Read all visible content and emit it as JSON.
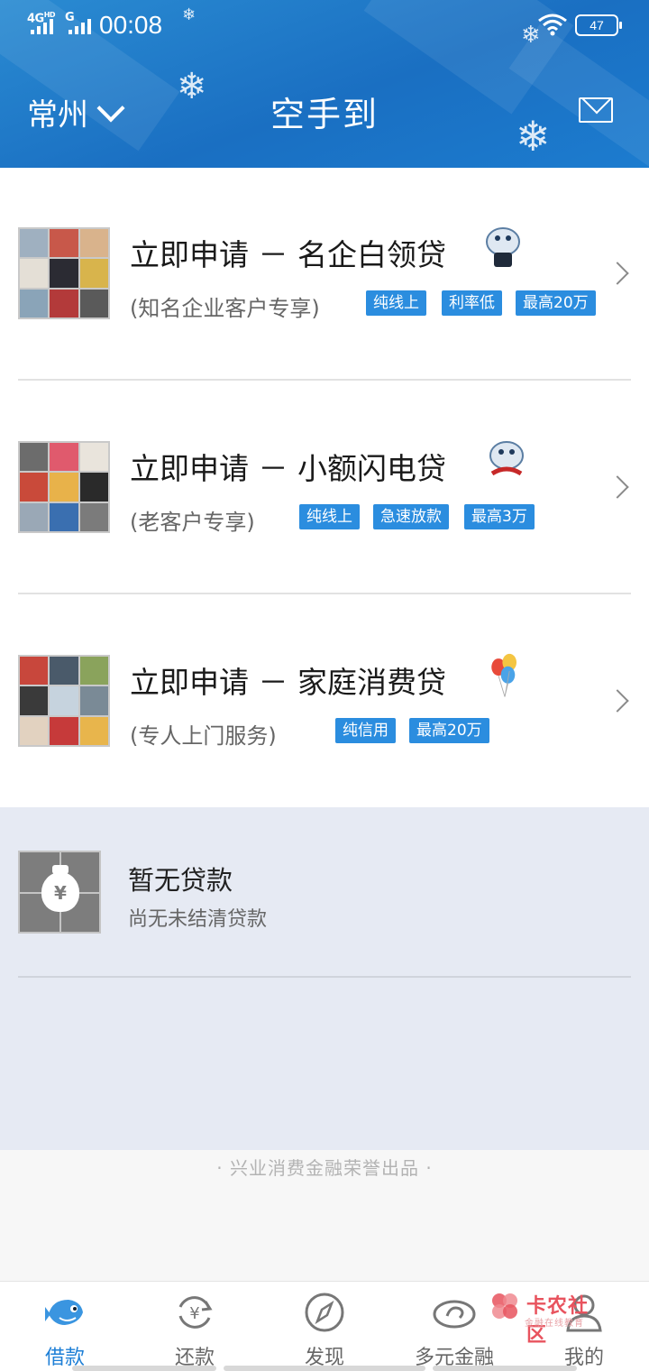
{
  "status_bar": {
    "network": "4G",
    "network_sup": "HD",
    "network2": "G",
    "time": "00:08",
    "battery": "47"
  },
  "header": {
    "city": "常州",
    "title": "空手到"
  },
  "loans": [
    {
      "title": "立即申请 － 名企白领贷",
      "subtitle": "(知名企业客户专享)",
      "tags": [
        "纯线上",
        "利率低",
        "最高20万"
      ]
    },
    {
      "title": "立即申请 － 小额闪电贷",
      "subtitle": "(老客户专享)",
      "tags": [
        "纯线上",
        "急速放款",
        "最高3万"
      ]
    },
    {
      "title": "立即申请 － 家庭消费贷",
      "subtitle": "(专人上门服务)",
      "tags": [
        "纯信用",
        "最高20万"
      ]
    }
  ],
  "no_loan": {
    "title": "暂无贷款",
    "subtitle": "尚无未结清贷款",
    "currency_symbol": "¥"
  },
  "footer_note": "· 兴业消费金融荣誉出品 ·",
  "tabs": [
    {
      "label": "借款",
      "icon": "fish-mascot-icon"
    },
    {
      "label": "还款",
      "icon": "yuan-refresh-icon"
    },
    {
      "label": "发现",
      "icon": "compass-icon"
    },
    {
      "label": "多元金融",
      "icon": "swirl-icon"
    },
    {
      "label": "我的",
      "icon": "user-icon"
    }
  ],
  "watermark": {
    "title": "卡农社区",
    "subtitle": "金融在线教育"
  },
  "colors": {
    "header_blue": "#1a6fc2",
    "tag_blue": "#2b8ddf",
    "active_tab": "#1e7fd6",
    "no_loan_bg": "#e6eaf3"
  }
}
